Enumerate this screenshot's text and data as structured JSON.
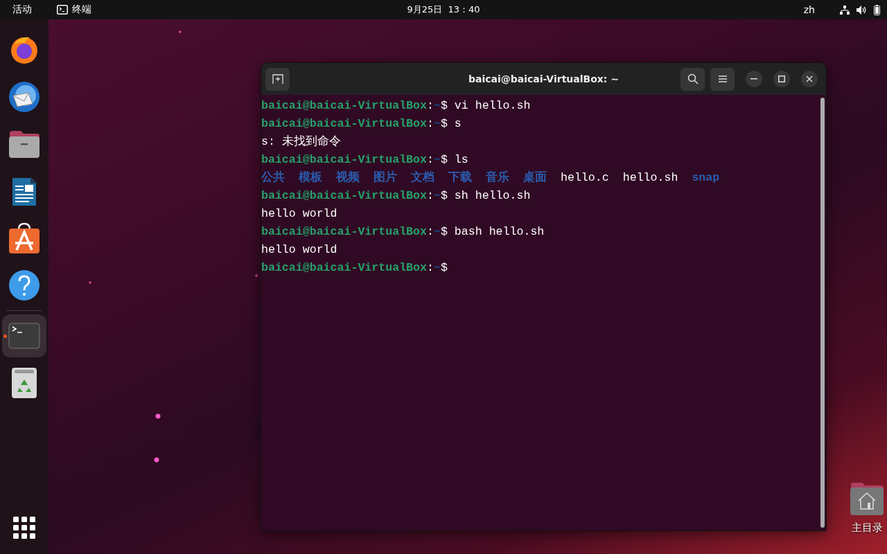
{
  "top_bar": {
    "activities": "活动",
    "app": {
      "label": "终端"
    },
    "clock": "9月25日  13：40",
    "input_method": "zh"
  },
  "dock": {
    "items": [
      {
        "kind": "firefox",
        "selected": false,
        "running": false
      },
      {
        "kind": "mail",
        "selected": false,
        "running": false
      },
      {
        "kind": "files",
        "selected": false,
        "running": false
      },
      {
        "kind": "writer",
        "selected": false,
        "running": false
      },
      {
        "kind": "store",
        "selected": false,
        "running": false
      },
      {
        "kind": "help",
        "selected": false,
        "running": false
      },
      {
        "kind": "terminal",
        "selected": true,
        "running": true
      },
      {
        "kind": "trash",
        "selected": false,
        "running": false
      }
    ]
  },
  "terminal": {
    "title": "baicai@baicai-VirtualBox: ~",
    "lines": [
      {
        "kind": "prompt",
        "user": "baicai@baicai-VirtualBox",
        "separator": ":",
        "path": "~",
        "symbol": "$",
        "command": "vi hello.sh"
      },
      {
        "kind": "prompt",
        "user": "baicai@baicai-VirtualBox",
        "separator": ":",
        "path": "~",
        "symbol": "$",
        "command": "s"
      },
      {
        "kind": "output",
        "text": "s: 未找到命令"
      },
      {
        "kind": "prompt",
        "user": "baicai@baicai-VirtualBox",
        "separator": ":",
        "path": "~",
        "symbol": "$",
        "command": "ls"
      },
      {
        "kind": "listing",
        "entries": [
          {
            "name": "公共",
            "kind": "dir"
          },
          {
            "name": "模板",
            "kind": "dir"
          },
          {
            "name": "视频",
            "kind": "dir"
          },
          {
            "name": "图片",
            "kind": "dir"
          },
          {
            "name": "文档",
            "kind": "dir"
          },
          {
            "name": "下载",
            "kind": "dir"
          },
          {
            "name": "音乐",
            "kind": "dir"
          },
          {
            "name": "桌面",
            "kind": "dir"
          },
          {
            "name": "hello.c",
            "kind": "file"
          },
          {
            "name": "hello.sh",
            "kind": "file"
          },
          {
            "name": "snap",
            "kind": "dir"
          }
        ]
      },
      {
        "kind": "prompt",
        "user": "baicai@baicai-VirtualBox",
        "separator": ":",
        "path": "~",
        "symbol": "$",
        "command": "sh hello.sh"
      },
      {
        "kind": "output",
        "text": "hello world"
      },
      {
        "kind": "prompt",
        "user": "baicai@baicai-VirtualBox",
        "separator": ":",
        "path": "~",
        "symbol": "$",
        "command": "bash hello.sh"
      },
      {
        "kind": "output",
        "text": "hello world"
      },
      {
        "kind": "prompt",
        "user": "baicai@baicai-VirtualBox",
        "separator": ":",
        "path": "~",
        "symbol": "$"
      }
    ]
  },
  "desktop_icons": [
    {
      "label": "主目录"
    }
  ]
}
